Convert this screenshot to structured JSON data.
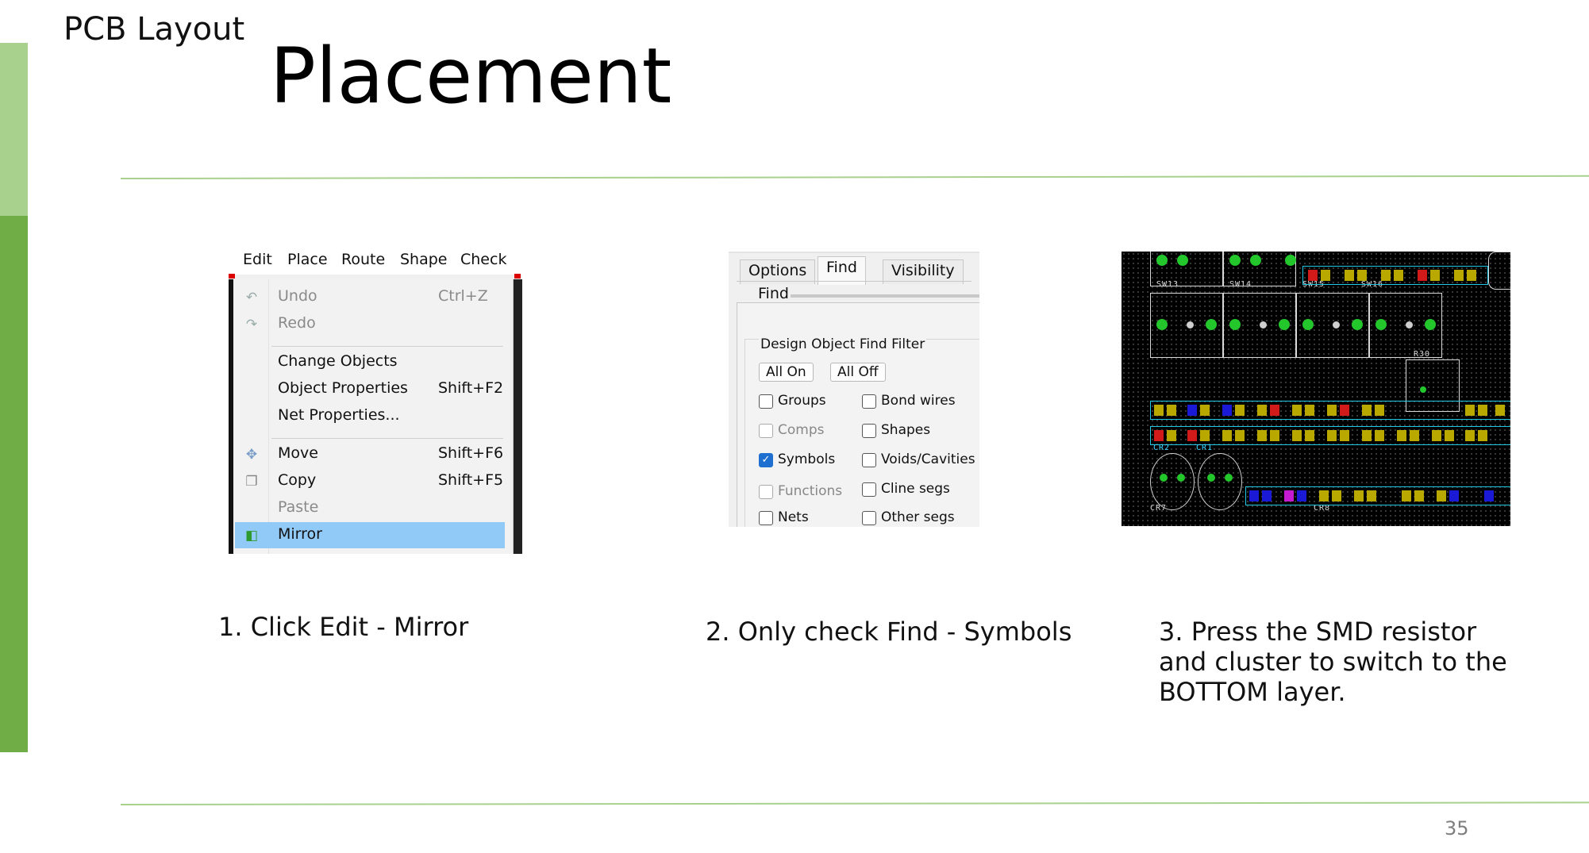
{
  "slide": {
    "section_label": "PCB Layout",
    "title": "Placement",
    "page_number": "35",
    "colors": {
      "accent_light": "#a9d18e",
      "accent_dark": "#70ad47"
    }
  },
  "steps": [
    {
      "caption": "1. Click Edit - Mirror"
    },
    {
      "caption": "2. Only check Find - Symbols"
    },
    {
      "caption": "3. Press the SMD resistor\nand cluster to switch to the\nBOTTOM layer."
    }
  ],
  "menu": {
    "menubar": [
      "Edit",
      "Place",
      "Route",
      "Shape",
      "Check"
    ],
    "items": [
      {
        "label": "Undo",
        "shortcut": "Ctrl+Z",
        "icon": "undo-icon",
        "enabled": false
      },
      {
        "label": "Redo",
        "shortcut": "",
        "icon": "redo-icon",
        "enabled": false
      },
      {
        "label": "Change Objects",
        "shortcut": "",
        "icon": "",
        "enabled": true
      },
      {
        "label": "Object Properties",
        "shortcut": "Shift+F2",
        "icon": "",
        "enabled": true
      },
      {
        "label": "Net Properties...",
        "shortcut": "",
        "icon": "",
        "enabled": true
      },
      {
        "label": "Move",
        "shortcut": "Shift+F6",
        "icon": "move-icon",
        "enabled": true
      },
      {
        "label": "Copy",
        "shortcut": "Shift+F5",
        "icon": "copy-icon",
        "enabled": true
      },
      {
        "label": "Paste",
        "shortcut": "",
        "icon": "",
        "enabled": false
      },
      {
        "label": "Mirror",
        "shortcut": "",
        "icon": "mirror-icon",
        "enabled": true,
        "selected": true
      }
    ],
    "selected_color": "#91c9f7"
  },
  "find_panel": {
    "tabs": [
      "Options",
      "Find",
      "Visibility"
    ],
    "active_tab": "Find",
    "heading": "Find",
    "filter_title": "Design Object Find Filter",
    "buttons": [
      "All On",
      "All Off"
    ],
    "checkboxes_left": [
      {
        "label": "Groups",
        "checked": false,
        "enabled": true
      },
      {
        "label": "Comps",
        "checked": false,
        "enabled": false
      },
      {
        "label": "Symbols",
        "checked": true,
        "enabled": true
      },
      {
        "label": "Functions",
        "checked": false,
        "enabled": false
      },
      {
        "label": "Nets",
        "checked": false,
        "enabled": true
      }
    ],
    "checkboxes_right": [
      {
        "label": "Bond wires",
        "checked": false,
        "enabled": true
      },
      {
        "label": "Shapes",
        "checked": false,
        "enabled": true
      },
      {
        "label": "Voids/Cavities",
        "checked": false,
        "enabled": true
      },
      {
        "label": "Cline segs",
        "checked": false,
        "enabled": true
      },
      {
        "label": "Other segs",
        "checked": false,
        "enabled": true
      }
    ]
  },
  "pcb_view": {
    "labels": [
      "SW13",
      "SW14",
      "SW15",
      "SW16",
      "R30",
      "CR2",
      "CR1",
      "CR7",
      "CR8"
    ],
    "colors": {
      "pad": "#23c62b",
      "outline_cyan": "#20c8e6",
      "smd_yellow": "#b8a800",
      "smd_blue": "#1a1ad6",
      "smd_red": "#d11a1a"
    }
  }
}
